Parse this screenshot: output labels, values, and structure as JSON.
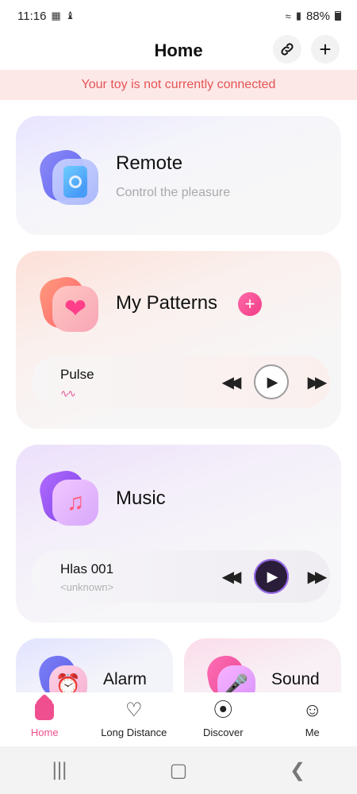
{
  "status": {
    "time": "11:16",
    "battery": "88%",
    "left_icons": [
      "windows-icon",
      "shield-icon"
    ],
    "right_icons": [
      "wifi-icon",
      "signal-icon",
      "battery-icon"
    ]
  },
  "header": {
    "title": "Home",
    "link_icon": "link-icon",
    "add_icon": "plus-icon"
  },
  "banner": {
    "text": "Your toy is not currently connected"
  },
  "cards": {
    "remote": {
      "title": "Remote",
      "subtitle": "Control the pleasure"
    },
    "patterns": {
      "title": "My Patterns",
      "player": {
        "track": "Pulse",
        "wave_icon": "wave-icon"
      }
    },
    "music": {
      "title": "Music",
      "player": {
        "track": "Hlas 001",
        "artist": "<unknown>"
      }
    },
    "alarm": {
      "title": "Alarm"
    },
    "sound": {
      "title": "Sound"
    }
  },
  "tabs": [
    {
      "label": "Home",
      "icon": "home-icon",
      "active": true
    },
    {
      "label": "Long Distance",
      "icon": "hearts-icon",
      "active": false
    },
    {
      "label": "Discover",
      "icon": "compass-icon",
      "active": false
    },
    {
      "label": "Me",
      "icon": "face-icon",
      "active": false
    }
  ],
  "colors": {
    "accent": "#ef4f8e",
    "banner_bg": "#fde8e8",
    "banner_text": "#e45454"
  }
}
